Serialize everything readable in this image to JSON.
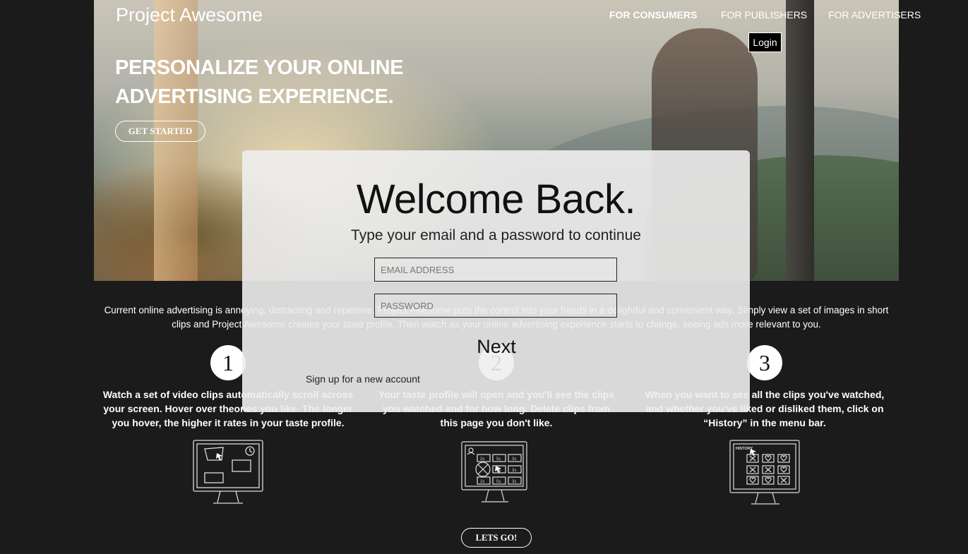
{
  "brand": "Project Awesome",
  "nav": {
    "consumers": "FOR CONSUMERS",
    "publishers": "FOR PUBLISHERS",
    "advertisers": "FOR ADVERTISERS",
    "login": "Login"
  },
  "hero": {
    "headline": "PERSONALIZE YOUR ONLINE ADVERTISING EXPERIENCE.",
    "cta": "GET STARTED"
  },
  "intro": "Current online advertising is annoying, distracting and repetitive. Project Awesome puts the control into your hands in a delightful and convenient way. Simply view a set of images in short clips and Project Awesome creates your taste profile. Then watch as your online advertising experience starts to change, seeing ads more relevant to you.",
  "steps": [
    {
      "number": "1",
      "text": "Watch a set of video clips automatically scroll across your screen. Hover over theones you like. The longer you hover, the higher it rates in your taste profile."
    },
    {
      "number": "2",
      "text": "Your taste profile will open and you'll see the clips you watched and for how long. Delete clips from this page you don't like."
    },
    {
      "number": "3",
      "text": "When you want to see all the clips you've watched, and whether you've liked or disliked them, click on “History” in the menu bar."
    }
  ],
  "monitor_labels": {
    "history": "HISTORY",
    "clip_times": [
      "2s",
      "5s",
      "3s",
      "3s",
      "3s",
      "2s",
      "5s",
      "3s"
    ]
  },
  "lets_go": "LETS GO!",
  "modal": {
    "title": "Welcome Back.",
    "subtitle": "Type your email and a password to continue",
    "email_placeholder": "EMAIL ADDRESS",
    "password_placeholder": "PASSWORD",
    "next": "Next",
    "signup": "Sign up for a new account"
  }
}
